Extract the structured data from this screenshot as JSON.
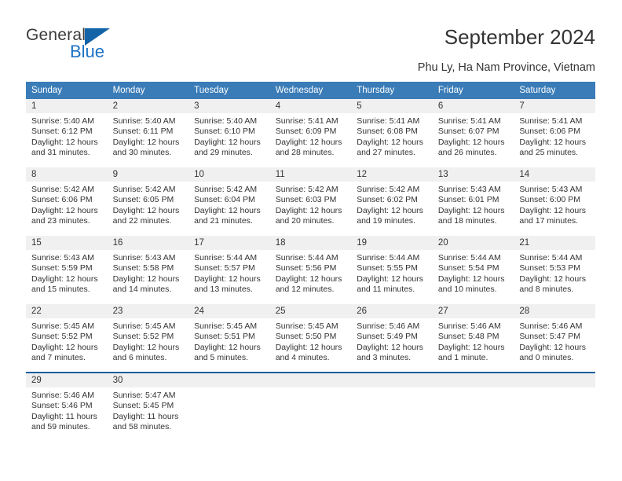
{
  "branding": {
    "name_part1": "General",
    "name_part2": "Blue",
    "triangle_color": "#1263a8",
    "blue_color": "#1a72c4"
  },
  "header": {
    "title": "September 2024",
    "subtitle": "Phu Ly, Ha Nam Province, Vietnam"
  },
  "calendar": {
    "header_bg": "#3a7cb8",
    "daynum_bg": "#f0f0f0",
    "accent": "#1b5f9e",
    "weekday_headers": [
      "Sunday",
      "Monday",
      "Tuesday",
      "Wednesday",
      "Thursday",
      "Friday",
      "Saturday"
    ],
    "weeks": [
      [
        {
          "day": "1",
          "sunrise": "Sunrise: 5:40 AM",
          "sunset": "Sunset: 6:12 PM",
          "daylight_line1": "Daylight: 12 hours",
          "daylight_line2": "and 31 minutes."
        },
        {
          "day": "2",
          "sunrise": "Sunrise: 5:40 AM",
          "sunset": "Sunset: 6:11 PM",
          "daylight_line1": "Daylight: 12 hours",
          "daylight_line2": "and 30 minutes."
        },
        {
          "day": "3",
          "sunrise": "Sunrise: 5:40 AM",
          "sunset": "Sunset: 6:10 PM",
          "daylight_line1": "Daylight: 12 hours",
          "daylight_line2": "and 29 minutes."
        },
        {
          "day": "4",
          "sunrise": "Sunrise: 5:41 AM",
          "sunset": "Sunset: 6:09 PM",
          "daylight_line1": "Daylight: 12 hours",
          "daylight_line2": "and 28 minutes."
        },
        {
          "day": "5",
          "sunrise": "Sunrise: 5:41 AM",
          "sunset": "Sunset: 6:08 PM",
          "daylight_line1": "Daylight: 12 hours",
          "daylight_line2": "and 27 minutes."
        },
        {
          "day": "6",
          "sunrise": "Sunrise: 5:41 AM",
          "sunset": "Sunset: 6:07 PM",
          "daylight_line1": "Daylight: 12 hours",
          "daylight_line2": "and 26 minutes."
        },
        {
          "day": "7",
          "sunrise": "Sunrise: 5:41 AM",
          "sunset": "Sunset: 6:06 PM",
          "daylight_line1": "Daylight: 12 hours",
          "daylight_line2": "and 25 minutes."
        }
      ],
      [
        {
          "day": "8",
          "sunrise": "Sunrise: 5:42 AM",
          "sunset": "Sunset: 6:06 PM",
          "daylight_line1": "Daylight: 12 hours",
          "daylight_line2": "and 23 minutes."
        },
        {
          "day": "9",
          "sunrise": "Sunrise: 5:42 AM",
          "sunset": "Sunset: 6:05 PM",
          "daylight_line1": "Daylight: 12 hours",
          "daylight_line2": "and 22 minutes."
        },
        {
          "day": "10",
          "sunrise": "Sunrise: 5:42 AM",
          "sunset": "Sunset: 6:04 PM",
          "daylight_line1": "Daylight: 12 hours",
          "daylight_line2": "and 21 minutes."
        },
        {
          "day": "11",
          "sunrise": "Sunrise: 5:42 AM",
          "sunset": "Sunset: 6:03 PM",
          "daylight_line1": "Daylight: 12 hours",
          "daylight_line2": "and 20 minutes."
        },
        {
          "day": "12",
          "sunrise": "Sunrise: 5:42 AM",
          "sunset": "Sunset: 6:02 PM",
          "daylight_line1": "Daylight: 12 hours",
          "daylight_line2": "and 19 minutes."
        },
        {
          "day": "13",
          "sunrise": "Sunrise: 5:43 AM",
          "sunset": "Sunset: 6:01 PM",
          "daylight_line1": "Daylight: 12 hours",
          "daylight_line2": "and 18 minutes."
        },
        {
          "day": "14",
          "sunrise": "Sunrise: 5:43 AM",
          "sunset": "Sunset: 6:00 PM",
          "daylight_line1": "Daylight: 12 hours",
          "daylight_line2": "and 17 minutes."
        }
      ],
      [
        {
          "day": "15",
          "sunrise": "Sunrise: 5:43 AM",
          "sunset": "Sunset: 5:59 PM",
          "daylight_line1": "Daylight: 12 hours",
          "daylight_line2": "and 15 minutes."
        },
        {
          "day": "16",
          "sunrise": "Sunrise: 5:43 AM",
          "sunset": "Sunset: 5:58 PM",
          "daylight_line1": "Daylight: 12 hours",
          "daylight_line2": "and 14 minutes."
        },
        {
          "day": "17",
          "sunrise": "Sunrise: 5:44 AM",
          "sunset": "Sunset: 5:57 PM",
          "daylight_line1": "Daylight: 12 hours",
          "daylight_line2": "and 13 minutes."
        },
        {
          "day": "18",
          "sunrise": "Sunrise: 5:44 AM",
          "sunset": "Sunset: 5:56 PM",
          "daylight_line1": "Daylight: 12 hours",
          "daylight_line2": "and 12 minutes."
        },
        {
          "day": "19",
          "sunrise": "Sunrise: 5:44 AM",
          "sunset": "Sunset: 5:55 PM",
          "daylight_line1": "Daylight: 12 hours",
          "daylight_line2": "and 11 minutes."
        },
        {
          "day": "20",
          "sunrise": "Sunrise: 5:44 AM",
          "sunset": "Sunset: 5:54 PM",
          "daylight_line1": "Daylight: 12 hours",
          "daylight_line2": "and 10 minutes."
        },
        {
          "day": "21",
          "sunrise": "Sunrise: 5:44 AM",
          "sunset": "Sunset: 5:53 PM",
          "daylight_line1": "Daylight: 12 hours",
          "daylight_line2": "and 8 minutes."
        }
      ],
      [
        {
          "day": "22",
          "sunrise": "Sunrise: 5:45 AM",
          "sunset": "Sunset: 5:52 PM",
          "daylight_line1": "Daylight: 12 hours",
          "daylight_line2": "and 7 minutes."
        },
        {
          "day": "23",
          "sunrise": "Sunrise: 5:45 AM",
          "sunset": "Sunset: 5:52 PM",
          "daylight_line1": "Daylight: 12 hours",
          "daylight_line2": "and 6 minutes."
        },
        {
          "day": "24",
          "sunrise": "Sunrise: 5:45 AM",
          "sunset": "Sunset: 5:51 PM",
          "daylight_line1": "Daylight: 12 hours",
          "daylight_line2": "and 5 minutes."
        },
        {
          "day": "25",
          "sunrise": "Sunrise: 5:45 AM",
          "sunset": "Sunset: 5:50 PM",
          "daylight_line1": "Daylight: 12 hours",
          "daylight_line2": "and 4 minutes."
        },
        {
          "day": "26",
          "sunrise": "Sunrise: 5:46 AM",
          "sunset": "Sunset: 5:49 PM",
          "daylight_line1": "Daylight: 12 hours",
          "daylight_line2": "and 3 minutes."
        },
        {
          "day": "27",
          "sunrise": "Sunrise: 5:46 AM",
          "sunset": "Sunset: 5:48 PM",
          "daylight_line1": "Daylight: 12 hours",
          "daylight_line2": "and 1 minute."
        },
        {
          "day": "28",
          "sunrise": "Sunrise: 5:46 AM",
          "sunset": "Sunset: 5:47 PM",
          "daylight_line1": "Daylight: 12 hours",
          "daylight_line2": "and 0 minutes."
        }
      ],
      [
        {
          "day": "29",
          "sunrise": "Sunrise: 5:46 AM",
          "sunset": "Sunset: 5:46 PM",
          "daylight_line1": "Daylight: 11 hours",
          "daylight_line2": "and 59 minutes."
        },
        {
          "day": "30",
          "sunrise": "Sunrise: 5:47 AM",
          "sunset": "Sunset: 5:45 PM",
          "daylight_line1": "Daylight: 11 hours",
          "daylight_line2": "and 58 minutes."
        },
        {
          "day": "",
          "sunrise": "",
          "sunset": "",
          "daylight_line1": "",
          "daylight_line2": ""
        },
        {
          "day": "",
          "sunrise": "",
          "sunset": "",
          "daylight_line1": "",
          "daylight_line2": ""
        },
        {
          "day": "",
          "sunrise": "",
          "sunset": "",
          "daylight_line1": "",
          "daylight_line2": ""
        },
        {
          "day": "",
          "sunrise": "",
          "sunset": "",
          "daylight_line1": "",
          "daylight_line2": ""
        },
        {
          "day": "",
          "sunrise": "",
          "sunset": "",
          "daylight_line1": "",
          "daylight_line2": ""
        }
      ]
    ]
  }
}
